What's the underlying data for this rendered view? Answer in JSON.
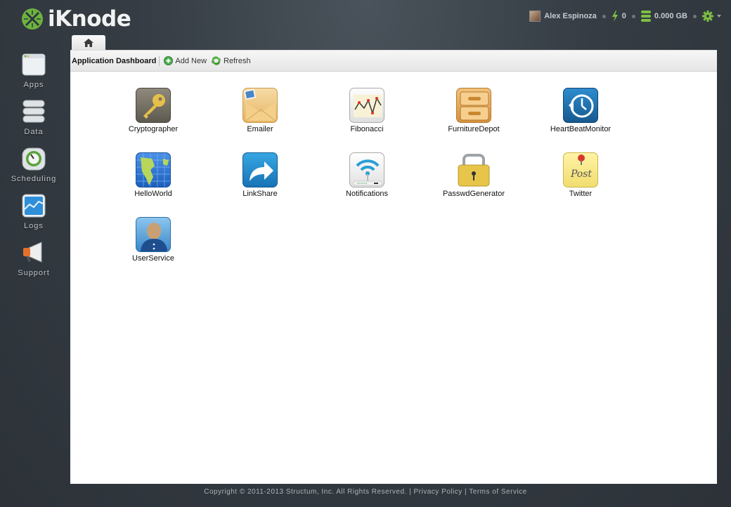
{
  "brand": {
    "name": "iKnode",
    "accent": "#6cb33f"
  },
  "topbar": {
    "user_name": "Alex Espinoza",
    "credits": "0",
    "storage": "0.000 GB"
  },
  "toolbar": {
    "title": "Application Dashboard",
    "add_new": "Add New",
    "refresh": "Refresh"
  },
  "sidebar": {
    "items": [
      {
        "label": "Apps",
        "icon": "window-icon"
      },
      {
        "label": "Data",
        "icon": "database-icon"
      },
      {
        "label": "Scheduling",
        "icon": "clock-icon"
      },
      {
        "label": "Logs",
        "icon": "chart-icon"
      },
      {
        "label": "Support",
        "icon": "megaphone-icon"
      }
    ]
  },
  "apps": [
    {
      "name": "Cryptographer",
      "icon": "key-icon"
    },
    {
      "name": "Emailer",
      "icon": "envelope-icon"
    },
    {
      "name": "Fibonacci",
      "icon": "line-chart-icon"
    },
    {
      "name": "FurnitureDepot",
      "icon": "drawer-icon"
    },
    {
      "name": "HeartBeatMonitor",
      "icon": "clock-refresh-icon"
    },
    {
      "name": "HelloWorld",
      "icon": "globe-icon"
    },
    {
      "name": "LinkShare",
      "icon": "share-arrow-icon"
    },
    {
      "name": "Notifications",
      "icon": "wifi-router-icon"
    },
    {
      "name": "PasswdGenerator",
      "icon": "padlock-icon"
    },
    {
      "name": "Twitter",
      "icon": "sticky-note-icon"
    },
    {
      "name": "UserService",
      "icon": "user-icon"
    }
  ],
  "footer": {
    "copyright": "Copyright © 2011-2013 Structum, Inc. All Rights Reserved.",
    "divider": "|",
    "privacy": "Privacy Policy",
    "terms": "Terms of Service"
  }
}
